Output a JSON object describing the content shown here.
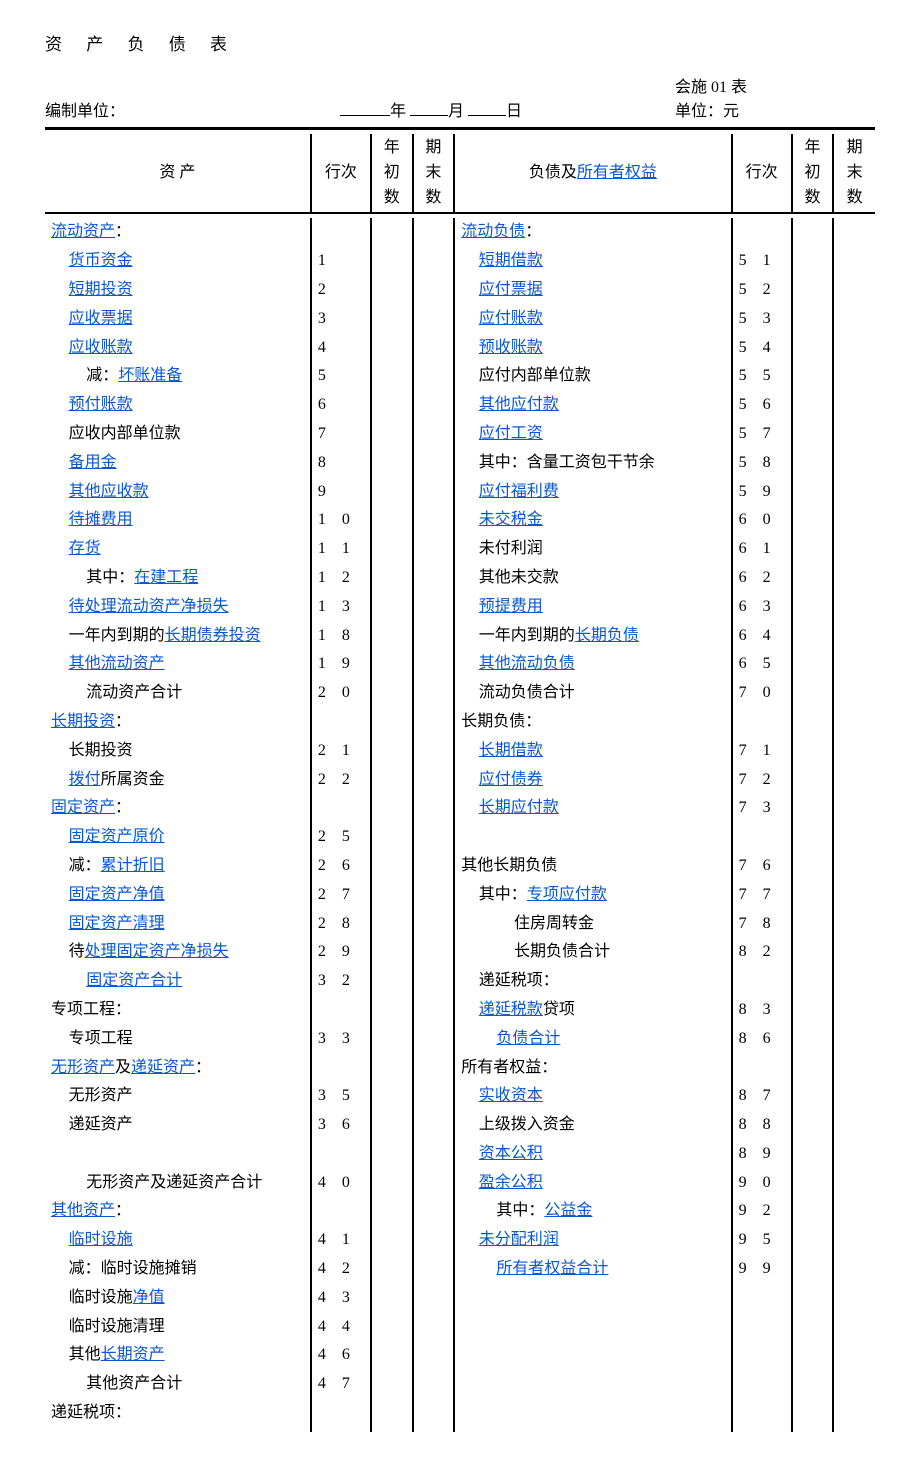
{
  "title": "资 产 负 债 表",
  "form_code": "会施 01 表",
  "prepared_by_label": "编制单位：",
  "date_year_label": "年",
  "date_month_label": "月",
  "date_day_label": "日",
  "unit_label": "单位：元",
  "columns": {
    "asset": "资    产",
    "row_no": "行次",
    "year_begin": "年初数",
    "period_end": "期末数",
    "liab_equity_prefix": "负债及",
    "liab_equity_link": "所有者权益"
  },
  "left": [
    {
      "indent": 0,
      "segs": [
        {
          "t": "流动资产",
          "l": true
        },
        {
          "t": "："
        }
      ],
      "num": ""
    },
    {
      "indent": 1,
      "segs": [
        {
          "t": "货币资金",
          "l": true
        }
      ],
      "num": "1"
    },
    {
      "indent": 1,
      "segs": [
        {
          "t": "短期投资",
          "l": true
        }
      ],
      "num": "2"
    },
    {
      "indent": 1,
      "segs": [
        {
          "t": "应收票据",
          "l": true
        }
      ],
      "num": "3"
    },
    {
      "indent": 1,
      "segs": [
        {
          "t": "应收账款",
          "l": true
        }
      ],
      "num": "4"
    },
    {
      "indent": 2,
      "segs": [
        {
          "t": "减："
        },
        {
          "t": "坏账准备",
          "l": true
        }
      ],
      "num": "5"
    },
    {
      "indent": 1,
      "segs": [
        {
          "t": "预付账款",
          "l": true
        }
      ],
      "num": "6"
    },
    {
      "indent": 1,
      "segs": [
        {
          "t": "应收内部单位款"
        }
      ],
      "num": "7"
    },
    {
      "indent": 1,
      "segs": [
        {
          "t": "备用金",
          "l": true
        }
      ],
      "num": "8"
    },
    {
      "indent": 1,
      "segs": [
        {
          "t": "其他应收款",
          "l": true
        }
      ],
      "num": "9"
    },
    {
      "indent": 1,
      "segs": [
        {
          "t": "待摊费用",
          "l": true
        }
      ],
      "num": "1 0"
    },
    {
      "indent": 1,
      "segs": [
        {
          "t": "存货",
          "l": true
        }
      ],
      "num": "1 1"
    },
    {
      "indent": 2,
      "segs": [
        {
          "t": "其中："
        },
        {
          "t": "在建工程",
          "l": true
        }
      ],
      "num": "1 2"
    },
    {
      "indent": 1,
      "segs": [
        {
          "t": "待处理流动资产净损失",
          "l": true
        }
      ],
      "num": "1 3"
    },
    {
      "indent": 1,
      "segs": [
        {
          "t": "一年内到期的"
        },
        {
          "t": "长期债券投资",
          "l": true
        }
      ],
      "num": "1 8"
    },
    {
      "indent": 1,
      "segs": [
        {
          "t": "其他流动资产",
          "l": true
        }
      ],
      "num": "1 9"
    },
    {
      "indent": 2,
      "segs": [
        {
          "t": "流动资产合计"
        }
      ],
      "num": "2 0"
    },
    {
      "indent": 0,
      "segs": [
        {
          "t": "长期投资",
          "l": true
        },
        {
          "t": "："
        }
      ],
      "num": ""
    },
    {
      "indent": 1,
      "segs": [
        {
          "t": "长期投资"
        }
      ],
      "num": "2 1"
    },
    {
      "indent": 1,
      "segs": [
        {
          "t": "拨付",
          "l": true
        },
        {
          "t": "所属资金"
        }
      ],
      "num": "2 2"
    },
    {
      "indent": 0,
      "segs": [
        {
          "t": "固定资产",
          "l": true
        },
        {
          "t": "："
        }
      ],
      "num": ""
    },
    {
      "indent": 1,
      "segs": [
        {
          "t": "固定资产原价",
          "l": true
        }
      ],
      "num": "2 5"
    },
    {
      "indent": 1,
      "segs": [
        {
          "t": "减："
        },
        {
          "t": "累计折旧",
          "l": true
        }
      ],
      "num": "2 6"
    },
    {
      "indent": 1,
      "segs": [
        {
          "t": "固定资产净值",
          "l": true
        }
      ],
      "num": "2 7"
    },
    {
      "indent": 1,
      "segs": [
        {
          "t": "固定资产清理",
          "l": true
        }
      ],
      "num": "2 8"
    },
    {
      "indent": 1,
      "segs": [
        {
          "t": "待"
        },
        {
          "t": "处理固定资产净损失",
          "l": true
        }
      ],
      "num": "2 9"
    },
    {
      "indent": 2,
      "segs": [
        {
          "t": "固定资产合计",
          "l": true
        }
      ],
      "num": "3 2"
    },
    {
      "indent": 0,
      "segs": [
        {
          "t": "专项工程："
        }
      ],
      "num": ""
    },
    {
      "indent": 1,
      "segs": [
        {
          "t": "专项工程"
        }
      ],
      "num": "3 3"
    },
    {
      "indent": 0,
      "segs": [
        {
          "t": "无形资产",
          "l": true
        },
        {
          "t": "及"
        },
        {
          "t": "递延资产",
          "l": true
        },
        {
          "t": "："
        }
      ],
      "num": ""
    },
    {
      "indent": 1,
      "segs": [
        {
          "t": "无形资产"
        }
      ],
      "num": "3 5"
    },
    {
      "indent": 1,
      "segs": [
        {
          "t": "递延资产"
        }
      ],
      "num": "3 6"
    },
    {
      "indent": 0,
      "segs": [
        {
          "t": ""
        }
      ],
      "num": ""
    },
    {
      "indent": 2,
      "segs": [
        {
          "t": "无形资产及递延资产合计"
        }
      ],
      "num": "4 0"
    },
    {
      "indent": 0,
      "segs": [
        {
          "t": "其他资产",
          "l": true
        },
        {
          "t": "："
        }
      ],
      "num": ""
    },
    {
      "indent": 1,
      "segs": [
        {
          "t": "临时设施",
          "l": true
        }
      ],
      "num": "4 1"
    },
    {
      "indent": 1,
      "segs": [
        {
          "t": "减：临时设施摊销"
        }
      ],
      "num": "4 2"
    },
    {
      "indent": 1,
      "segs": [
        {
          "t": "临时设施"
        },
        {
          "t": "净值",
          "l": true
        }
      ],
      "num": "4 3"
    },
    {
      "indent": 1,
      "segs": [
        {
          "t": "临时设施清理"
        }
      ],
      "num": "4 4"
    },
    {
      "indent": 1,
      "segs": [
        {
          "t": "其他"
        },
        {
          "t": "长期资产",
          "l": true
        }
      ],
      "num": "4 6"
    },
    {
      "indent": 2,
      "segs": [
        {
          "t": "其他资产合计"
        }
      ],
      "num": "4 7"
    },
    {
      "indent": 0,
      "segs": [
        {
          "t": "递延税项："
        }
      ],
      "num": ""
    }
  ],
  "right": [
    {
      "indent": 0,
      "segs": [
        {
          "t": "流动负债",
          "l": true
        },
        {
          "t": "："
        }
      ],
      "num": ""
    },
    {
      "indent": 1,
      "segs": [
        {
          "t": "短期借款",
          "l": true
        }
      ],
      "num": "5 1"
    },
    {
      "indent": 1,
      "segs": [
        {
          "t": "应付票据",
          "l": true
        }
      ],
      "num": "5 2"
    },
    {
      "indent": 1,
      "segs": [
        {
          "t": "应付账款",
          "l": true
        }
      ],
      "num": "5 3"
    },
    {
      "indent": 1,
      "segs": [
        {
          "t": "预收账款",
          "l": true
        }
      ],
      "num": "5 4"
    },
    {
      "indent": 1,
      "segs": [
        {
          "t": "应付内部单位款"
        }
      ],
      "num": "5 5"
    },
    {
      "indent": 1,
      "segs": [
        {
          "t": "其他应付款",
          "l": true
        }
      ],
      "num": "5 6"
    },
    {
      "indent": 1,
      "segs": [
        {
          "t": "应付工资",
          "l": true
        }
      ],
      "num": "5 7"
    },
    {
      "indent": 1,
      "segs": [
        {
          "t": "其中：含量工资包干节余"
        }
      ],
      "num": "5 8"
    },
    {
      "indent": 1,
      "segs": [
        {
          "t": "应付福利费",
          "l": true
        }
      ],
      "num": "5 9"
    },
    {
      "indent": 1,
      "segs": [
        {
          "t": "未交税金",
          "l": true
        }
      ],
      "num": "6 0"
    },
    {
      "indent": 1,
      "segs": [
        {
          "t": "未付利润"
        }
      ],
      "num": "6 1"
    },
    {
      "indent": 1,
      "segs": [
        {
          "t": "其他未交款"
        }
      ],
      "num": "6 2"
    },
    {
      "indent": 1,
      "segs": [
        {
          "t": "预提费用",
          "l": true
        }
      ],
      "num": "6 3"
    },
    {
      "indent": 1,
      "segs": [
        {
          "t": "一年内到期的"
        },
        {
          "t": "长期负债",
          "l": true
        }
      ],
      "num": "6 4"
    },
    {
      "indent": 1,
      "segs": [
        {
          "t": "其他流动负债",
          "l": true
        }
      ],
      "num": "6 5"
    },
    {
      "indent": 1,
      "segs": [
        {
          "t": "流动负债合计"
        }
      ],
      "num": "7 0"
    },
    {
      "indent": 0,
      "segs": [
        {
          "t": "长期负债："
        }
      ],
      "num": ""
    },
    {
      "indent": 1,
      "segs": [
        {
          "t": "长期借款",
          "l": true
        }
      ],
      "num": "7 1"
    },
    {
      "indent": 1,
      "segs": [
        {
          "t": "应付债券",
          "l": true
        }
      ],
      "num": "7 2"
    },
    {
      "indent": 1,
      "segs": [
        {
          "t": "长期应付款",
          "l": true
        }
      ],
      "num": "7 3"
    },
    {
      "indent": 0,
      "segs": [
        {
          "t": ""
        }
      ],
      "num": ""
    },
    {
      "indent": 0,
      "segs": [
        {
          "t": "其他长期负债"
        }
      ],
      "num": "7 6"
    },
    {
      "indent": 1,
      "segs": [
        {
          "t": "其中："
        },
        {
          "t": "专项应付款",
          "l": true
        }
      ],
      "num": "7 7"
    },
    {
      "indent": 3,
      "segs": [
        {
          "t": "住房周转金"
        }
      ],
      "num": "7 8"
    },
    {
      "indent": 3,
      "segs": [
        {
          "t": "长期负债合计"
        }
      ],
      "num": "8 2"
    },
    {
      "indent": 1,
      "segs": [
        {
          "t": "递延税项："
        }
      ],
      "num": ""
    },
    {
      "indent": 1,
      "segs": [
        {
          "t": "递延税款",
          "l": true
        },
        {
          "t": "贷项"
        }
      ],
      "num": "8 3"
    },
    {
      "indent": 2,
      "segs": [
        {
          "t": "负债合计",
          "l": true
        }
      ],
      "num": "8 6"
    },
    {
      "indent": 0,
      "segs": [
        {
          "t": "所有者权益："
        }
      ],
      "num": ""
    },
    {
      "indent": 1,
      "segs": [
        {
          "t": "实收资本",
          "l": true
        }
      ],
      "num": "8 7"
    },
    {
      "indent": 1,
      "segs": [
        {
          "t": "上级拨入资金"
        }
      ],
      "num": "8 8"
    },
    {
      "indent": 1,
      "segs": [
        {
          "t": "资本公积",
          "l": true
        }
      ],
      "num": "8 9"
    },
    {
      "indent": 1,
      "segs": [
        {
          "t": "盈余公积",
          "l": true
        }
      ],
      "num": "9 0"
    },
    {
      "indent": 2,
      "segs": [
        {
          "t": "其中："
        },
        {
          "t": "公益金",
          "l": true
        }
      ],
      "num": "9 2"
    },
    {
      "indent": 1,
      "segs": [
        {
          "t": "未分配利润",
          "l": true
        }
      ],
      "num": "9 5"
    },
    {
      "indent": 2,
      "segs": [
        {
          "t": "所有者权益合计",
          "l": true
        }
      ],
      "num": "9 9"
    },
    {
      "indent": 0,
      "segs": [
        {
          "t": ""
        }
      ],
      "num": ""
    },
    {
      "indent": 0,
      "segs": [
        {
          "t": ""
        }
      ],
      "num": ""
    },
    {
      "indent": 0,
      "segs": [
        {
          "t": ""
        }
      ],
      "num": ""
    },
    {
      "indent": 0,
      "segs": [
        {
          "t": ""
        }
      ],
      "num": ""
    },
    {
      "indent": 0,
      "segs": [
        {
          "t": ""
        }
      ],
      "num": ""
    },
    {
      "indent": 0,
      "segs": [
        {
          "t": ""
        }
      ],
      "num": ""
    }
  ]
}
